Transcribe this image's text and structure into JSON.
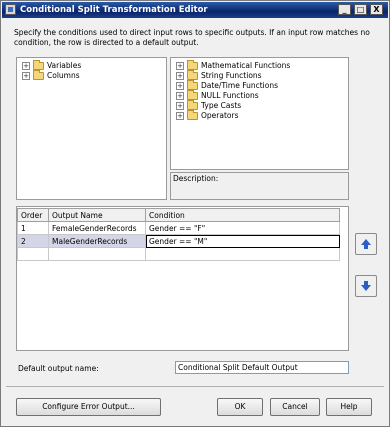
{
  "window": {
    "title": "Conditional Split Transformation Editor",
    "minimize": "_",
    "maximize": "□",
    "close": "X"
  },
  "instructions": "Specify the conditions used to direct input rows to specific outputs. If an input row matches no condition, the row is directed to a default output.",
  "left_tree": [
    {
      "label": "Variables"
    },
    {
      "label": "Columns"
    }
  ],
  "right_tree": [
    {
      "label": "Mathematical Functions"
    },
    {
      "label": "String Functions"
    },
    {
      "label": "Date/Time Functions"
    },
    {
      "label": "NULL Functions"
    },
    {
      "label": "Type Casts"
    },
    {
      "label": "Operators"
    }
  ],
  "expander_glyph": "+",
  "description_label": "Description:",
  "grid": {
    "headers": {
      "order": "Order",
      "output_name": "Output Name",
      "condition": "Condition"
    },
    "rows": [
      {
        "order": "1",
        "output_name": "FemaleGenderRecords",
        "condition": "Gender == \"F\""
      },
      {
        "order": "2",
        "output_name": "MaleGenderRecords",
        "condition": "Gender == \"M\""
      }
    ]
  },
  "default_output": {
    "label": "Default output name:",
    "value": "Conditional Split Default Output"
  },
  "buttons": {
    "configure_error": "Configure Error Output...",
    "ok": "OK",
    "cancel": "Cancel",
    "help": "Help"
  },
  "colors": {
    "arrow": "#2b5fc4",
    "title_bar": "#0a246a"
  }
}
